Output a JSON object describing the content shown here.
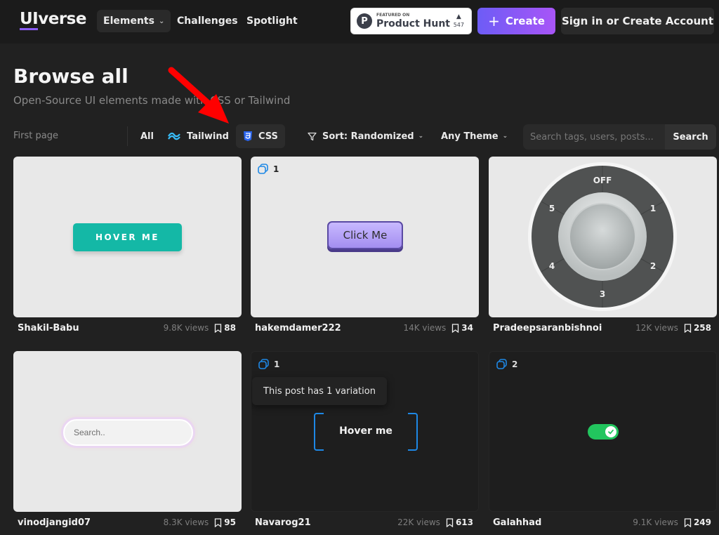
{
  "header": {
    "logo_ui": "UI",
    "logo_rest": "verse",
    "nav": {
      "elements": "Elements",
      "challenges": "Challenges",
      "spotlight": "Spotlight"
    },
    "product_hunt": {
      "featured": "FEATURED ON",
      "name": "Product Hunt",
      "votes": "547"
    },
    "create_label": "Create",
    "signin_label": "Sign in or Create Account"
  },
  "page": {
    "title": "Browse all",
    "subtitle": "Open-Source UI elements made with CSS or Tailwind"
  },
  "filters": {
    "first_page": "First page",
    "all": "All",
    "tailwind": "Tailwind",
    "css": "CSS",
    "sort": "Sort: Randomized",
    "theme": "Any Theme",
    "search_placeholder": "Search tags, users, posts...",
    "search_button": "Search"
  },
  "cards": [
    {
      "author": "Shakil-Babu",
      "views": "9.8K views",
      "bookmarks": "88",
      "theme": "light",
      "preview_text": "HOVER ME"
    },
    {
      "author": "hakemdamer222",
      "views": "14K views",
      "bookmarks": "34",
      "theme": "light",
      "variations": "1",
      "preview_text": "Click Me"
    },
    {
      "author": "Pradeepsaranbishnoi",
      "views": "12K views",
      "bookmarks": "258",
      "theme": "light",
      "knob_labels": [
        "OFF",
        "1",
        "2",
        "3",
        "4",
        "5"
      ]
    },
    {
      "author": "vinodjangid07",
      "views": "8.3K views",
      "bookmarks": "95",
      "theme": "light",
      "preview_text": "Search.."
    },
    {
      "author": "Navarog21",
      "views": "22K views",
      "bookmarks": "613",
      "theme": "dark",
      "variations": "1",
      "tooltip": "This post has 1 variation",
      "preview_text": "Hover me"
    },
    {
      "author": "Galahhad",
      "views": "9.1K views",
      "bookmarks": "249",
      "theme": "dark",
      "variations": "2"
    }
  ],
  "colors": {
    "accent": "#8b5cf6",
    "teal": "#14b8a6",
    "blue": "#1e88e5",
    "green": "#22c55e",
    "annotation_arrow": "#ff0000"
  }
}
